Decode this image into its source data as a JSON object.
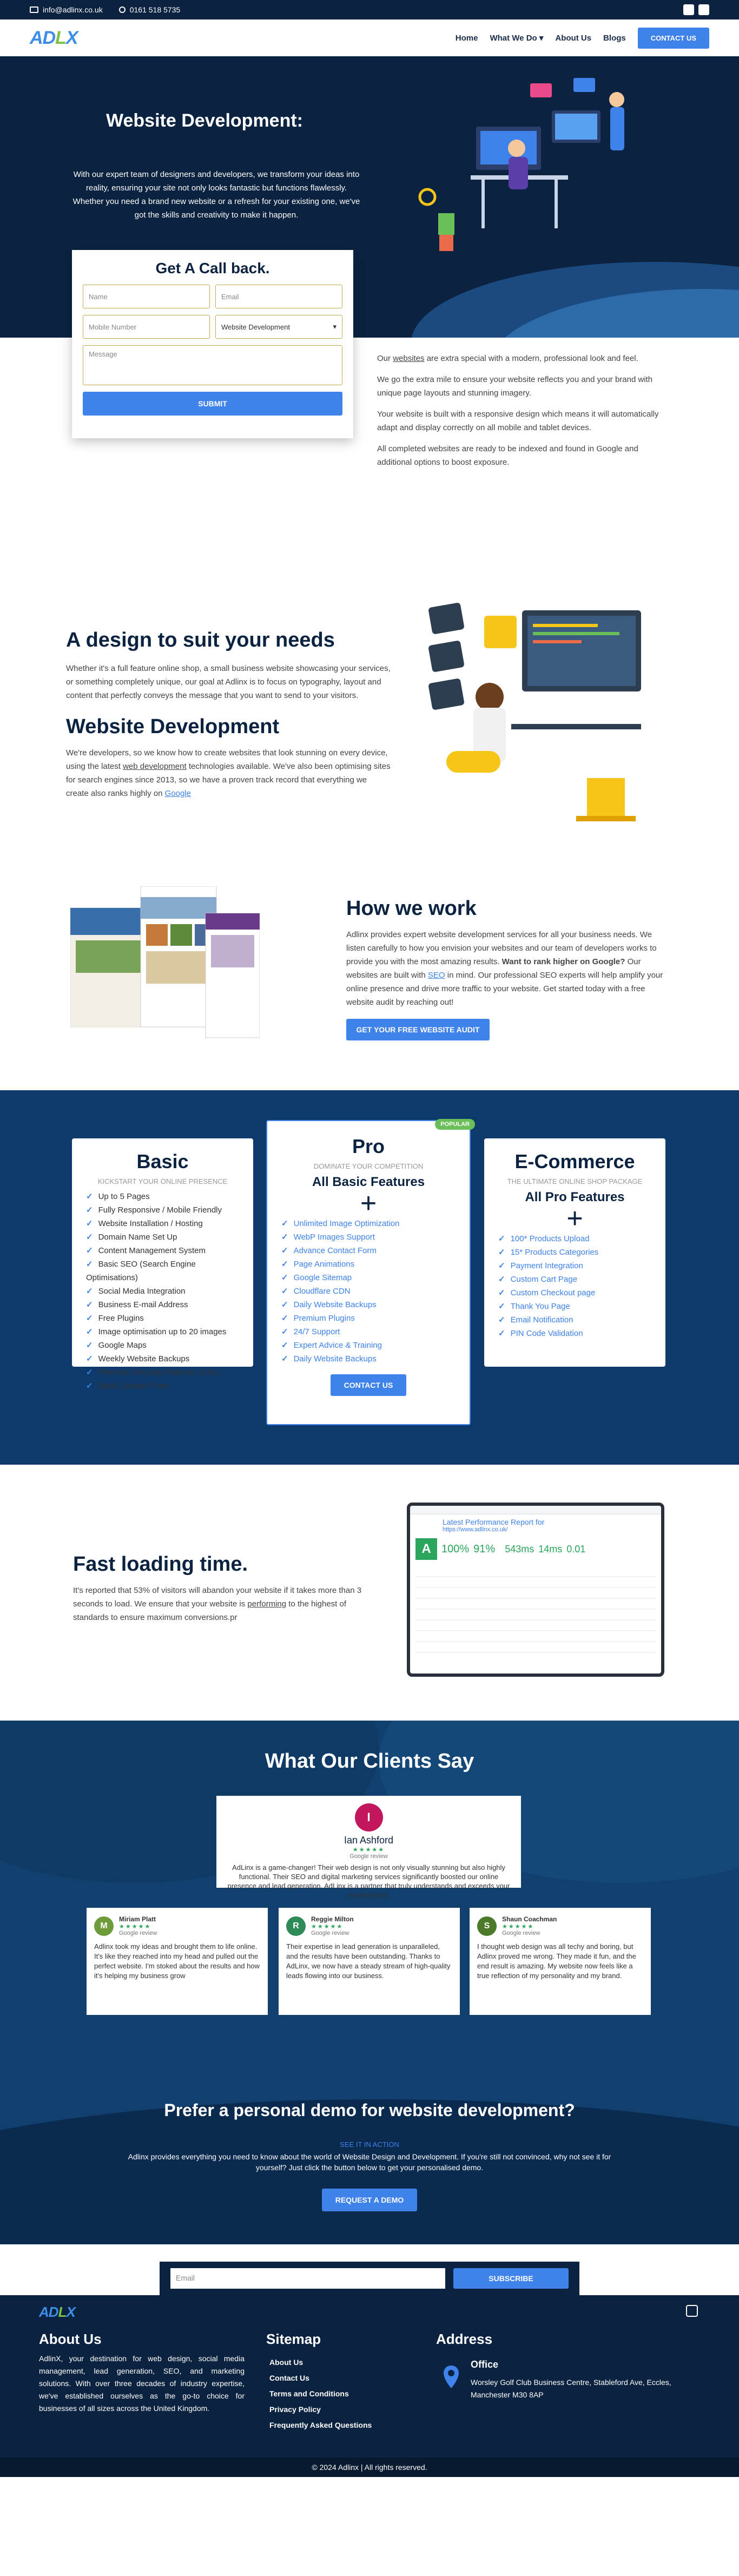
{
  "topbar": {
    "email": "info@adlinx.co.uk",
    "phone": "0161 518 5735"
  },
  "header": {
    "logo": "ADLINX",
    "nav": [
      "Home",
      "What We Do ▾",
      "About Us",
      "Blogs"
    ],
    "contact_btn": "CONTACT US"
  },
  "hero": {
    "title": "Website Development:",
    "text": "With our expert team of designers and developers, we transform your ideas into reality, ensuring your site not only looks fantastic but functions flawlessly. Whether you need a brand new website or a refresh for your existing one, we've got the skills and creativity to make it happen."
  },
  "form": {
    "title": "Get A Call back.",
    "name_ph": "Name",
    "email_ph": "Email",
    "mobile_ph": "Mobile Number",
    "service_value": "Website Development",
    "message_ph": "Message",
    "submit": "SUBMIT"
  },
  "intro": {
    "p1a": "Our ",
    "p1link": "websites",
    "p1b": " are extra special with a modern, professional look and feel.",
    "p2": "We go the extra mile to ensure your website reflects you and your brand with unique page layouts and stunning imagery.",
    "p3": "Your website is built with a responsive design which means it will automatically adapt and display correctly on all mobile and tablet devices.",
    "p4": "All completed websites are ready to be indexed and found in Google and additional options to boost exposure."
  },
  "design": {
    "title": "A design to suit your needs",
    "text": "Whether it's a full feature online shop, a small business website showcasing your services, or something completely unique, our goal at Adlinx is to focus on typography, layout and content that perfectly conveys the message that you want to send to your visitors.",
    "title2": "Website Development",
    "text2a": "We're developers, so we know how to create websites that look stunning on every device, using the latest ",
    "text2link": "web development",
    "text2b": " technologies available. We've also been optimising sites for search engines since 2013, so we have a proven track record that everything we create also ranks highly on ",
    "text2link2": "Google"
  },
  "how": {
    "title": "How we work",
    "text_a": "Adlinx provides expert website development services for all your business needs. We listen carefully to how you envision your websites and our team of developers works to provide you with the most amazing results. ",
    "bold": "Want to rank higher on Google?",
    "text_b": " Our websites are built with ",
    "seo": "SEO",
    "text_c": " in mind. Our professional SEO experts will help amplify your online presence and drive more traffic to your website. Get started today with a free website audit by reaching out!",
    "btn": "GET YOUR FREE WEBSITE AUDIT"
  },
  "pricing": {
    "basic": {
      "name": "Basic",
      "sub": "KICKSTART YOUR ONLINE PRESENCE",
      "items": [
        "Up to 5 Pages",
        "Fully Responsive / Mobile Friendly",
        "Website Installation / Hosting",
        "Domain Name Set Up",
        "Content Management System",
        "Basic SEO (Search Engine Optimisations)",
        "Social Media Integration",
        "Business E-mail Address",
        "Free Plugins",
        "Image optimisation up to 20 images",
        "Google Maps",
        "Weekly Website Backups",
        "Premium Security Features (SSL)",
        "Basic Contact Form"
      ]
    },
    "pro": {
      "name": "Pro",
      "badge": "POPULAR",
      "sub": "DOMINATE YOUR COMPETITION",
      "heading": "All Basic Features",
      "items": [
        "Unlimited Image Optimization",
        "WebP Images Support",
        "Advance Contact Form",
        "Page Animations",
        "Google Sitemap",
        "Cloudflare CDN",
        "Daily Website Backups",
        "Premium Plugins",
        "24/7 Support",
        "Expert Advice & Training",
        "Daily Website Backups"
      ],
      "btn": "CONTACT US"
    },
    "ecom": {
      "name": "E-Commerce",
      "sub": "THE ULTIMATE ONLINE SHOP PACKAGE",
      "heading": "All Pro Features",
      "items": [
        "100* Products Upload",
        "15* Products Categories",
        "Payment Integration",
        "Custom Cart Page",
        "Custom Checkout page",
        "Thank You Page",
        "Email Notification",
        "PIN Code Validation"
      ]
    }
  },
  "fast": {
    "title": "Fast loading time.",
    "text_a": "It's reported that 53% of visitors will abandon your website if it takes more than 3 seconds to load. We ensure that your website is ",
    "link": "performing",
    "text_b": " to the highest of standards to ensure maximum conversions.pr",
    "report_title": "Latest Performance Report for",
    "report_url": "https://www.adlinx.co.uk/",
    "grade": "A",
    "perf": "100%",
    "struct": "91%",
    "lcp": "543ms",
    "tbt": "14ms",
    "cls": "0.01"
  },
  "testimonials": {
    "title": "What Our Clients Say",
    "main": {
      "initial": "I",
      "name": "Ian Ashford",
      "source": "Google review",
      "text": "AdLinx is a game-changer! Their web design is not only visually stunning but also highly functional. Their SEO and digital marketing services significantly boosted our online presence and lead generation. AdLinx is a partner that truly understands and exceeds your expectations."
    },
    "cards": [
      {
        "initial": "M",
        "name": "Miriam Platt",
        "source": "Google review",
        "text": "Adlinx took my ideas and brought them to life online. It's like they reached into my head and pulled out the perfect website. I'm stoked about the results and how it's helping my business grow",
        "color": "#6e9b3a"
      },
      {
        "initial": "R",
        "name": "Reggie Milton",
        "source": "Google review",
        "text": "Their expertise in lead generation is unparalleled, and the results have been outstanding. Thanks to AdLinx, we now have a steady stream of high-quality leads flowing into our business.",
        "color": "#2e8b57"
      },
      {
        "initial": "S",
        "name": "Shaun Coachman",
        "source": "Google review",
        "text": "I thought web design was all techy and boring, but Adlinx proved me wrong. They made it fun, and the end result is amazing. My website now feels like a true reflection of my personality and my brand.",
        "color": "#4c7a2a"
      }
    ]
  },
  "demo": {
    "title": "Prefer a personal demo for website development?",
    "link": "SEE IT IN ACTION",
    "text": "Adlinx provides everything you need to know about the world of Website Design and Development. If you're still not convinced, why not see it for yourself? Just click the button below to get your personalised demo.",
    "btn": "REQUEST A DEMO"
  },
  "newsletter": {
    "placeholder": "Email",
    "btn": "SUBSCRIBE"
  },
  "footer": {
    "about_title": "About Us",
    "about_text": "AdlinX, your destination for web design, social media management, lead generation, SEO, and marketing solutions. With over three decades of industry expertise, we've established ourselves as the go-to choice for businesses of all sizes across the United Kingdom.",
    "sitemap_title": "Sitemap",
    "links": [
      "About Us",
      "Contact Us",
      "Terms and Conditions",
      "Privacy Policy",
      "Frequently Asked Questions"
    ],
    "address_title": "Address",
    "office": "Office",
    "address": "Worsley Golf Club Business Centre, Stableford Ave, Eccles, Manchester M30 8AP"
  },
  "copyright": "© 2024 Adlinx | All rights reserved."
}
